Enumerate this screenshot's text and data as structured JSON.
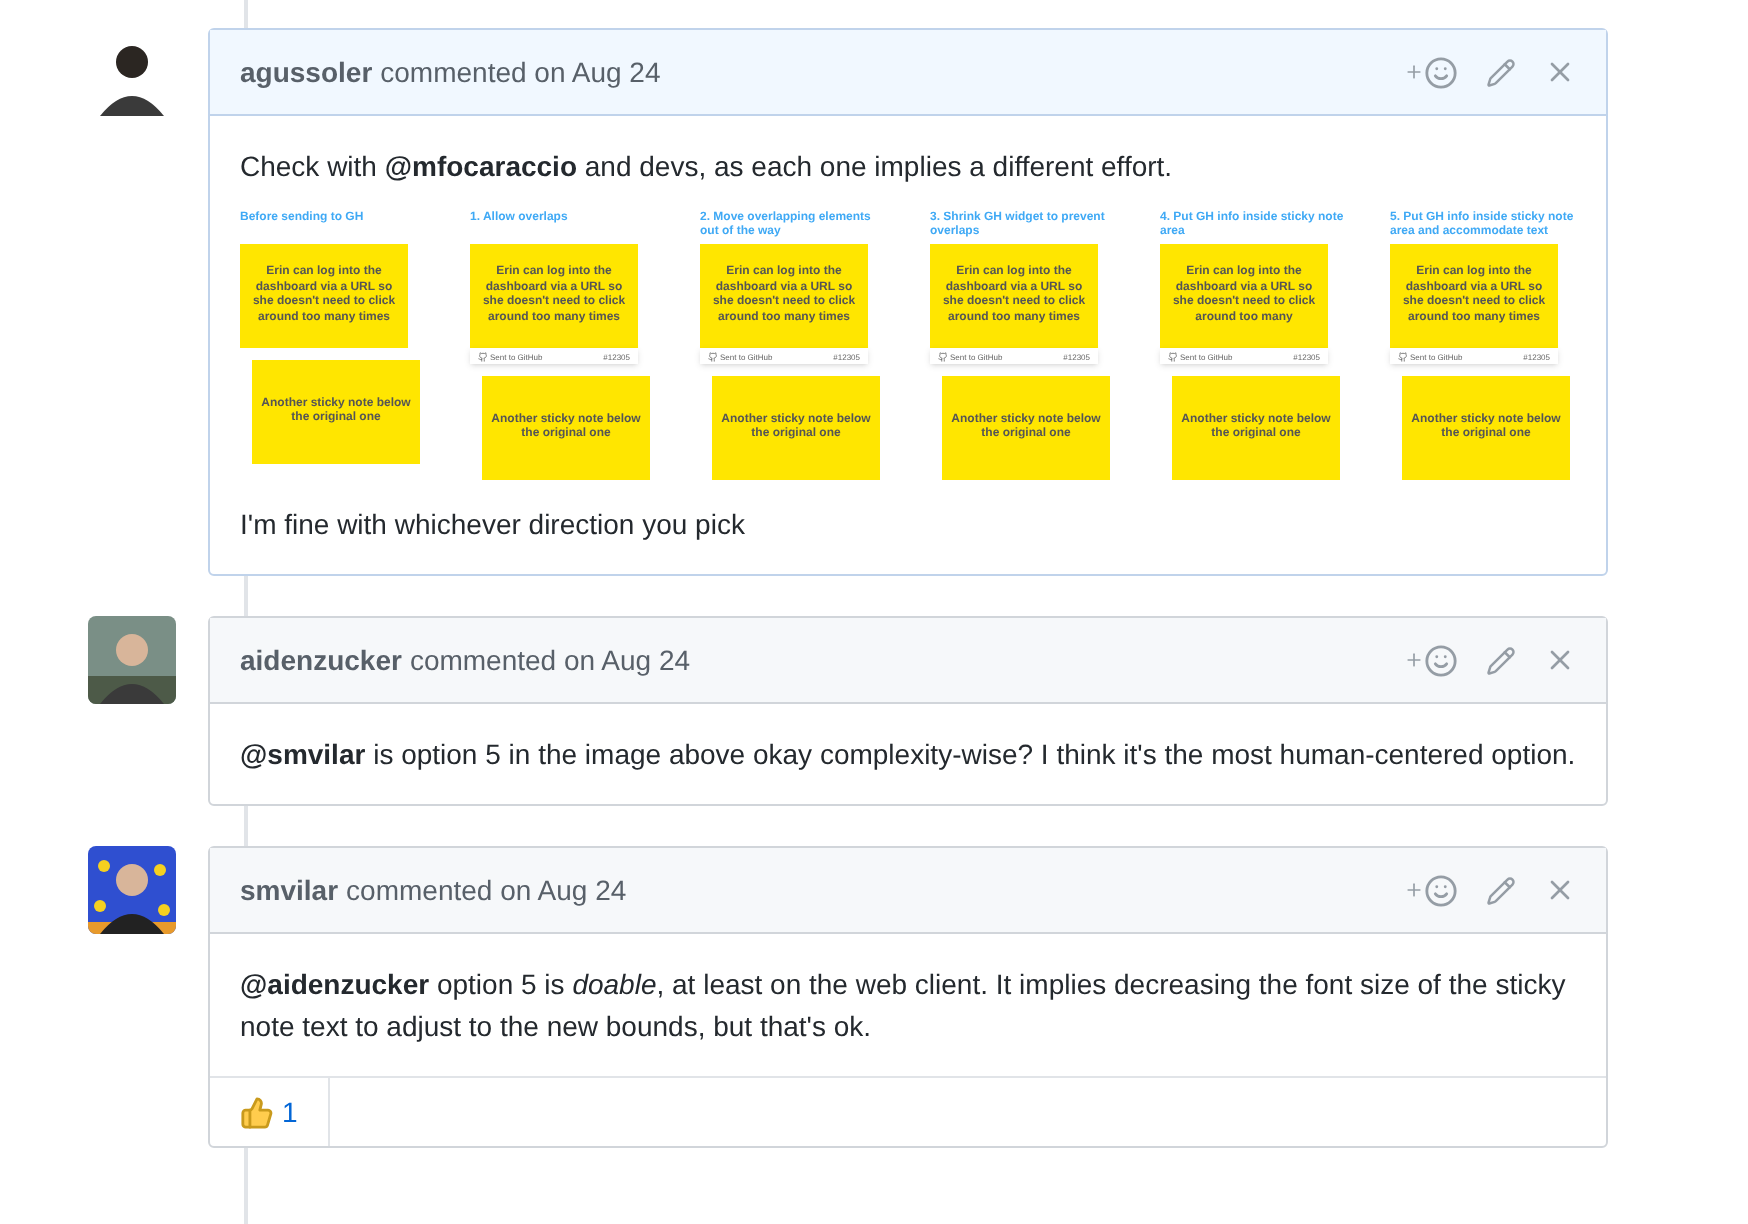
{
  "comments": [
    {
      "author": "agussoler",
      "action": "commented on Aug 24",
      "highlighted": true,
      "avatar": {
        "kind": "plain"
      },
      "body": [
        {
          "kind": "text",
          "text": "Check with **@mfocaraccio** and devs, as each one implies a different effort."
        },
        {
          "kind": "mockups",
          "columns": [
            {
              "title": "Before sending to GH",
              "note": "Erin can log into the dashboard via a URL so she doesn't need to click around too many times",
              "second_note": "Another sticky note below the original one"
            },
            {
              "title": "1. Allow overlaps",
              "note": "Erin can log into the dashboard via a URL so she doesn't need to click around too many times",
              "github_bar": {
                "label": "Sent to GitHub",
                "number": "#12305"
              },
              "second_note": "Another sticky note below the original one"
            },
            {
              "title": "2. Move overlapping elements out of the way",
              "note": "Erin can log into the dashboard via a URL so she doesn't need to click around too many times",
              "github_bar": {
                "label": "Sent to GitHub",
                "number": "#12305"
              },
              "second_note": "Another sticky note below the original one"
            },
            {
              "title": "3. Shrink GH widget to prevent overlaps",
              "note": "Erin can log into the dashboard via a URL so she doesn't need to click around too many times",
              "github_bar": {
                "label": "Sent to GitHub",
                "number": "#12305"
              },
              "second_note": "Another sticky note below the original one"
            },
            {
              "title": "4. Put GH info inside sticky note area",
              "note": "Erin can log into the dashboard via a URL so she doesn't need to click around too many",
              "github_bar": {
                "label": "Sent to GitHub",
                "number": "#12305"
              },
              "second_note": "Another sticky note below the original one"
            },
            {
              "title": "5. Put GH info inside sticky note area and accommodate text",
              "note": "Erin can log into the dashboard via a URL so she doesn't need to click around too many times",
              "github_bar": {
                "label": "Sent to GitHub",
                "number": "#12305"
              },
              "second_note": "Another sticky note below the original one"
            }
          ]
        },
        {
          "kind": "text",
          "text": "I'm fine with whichever direction you pick"
        }
      ]
    },
    {
      "author": "aidenzucker",
      "action": "commented on Aug 24",
      "highlighted": false,
      "avatar": {
        "kind": "outdoor"
      },
      "body": [
        {
          "kind": "text",
          "text": "**@smvilar** is option 5 in the image above okay complexity-wise? I think it's the most human-centered option."
        }
      ]
    },
    {
      "author": "smvilar",
      "action": "commented on Aug 24",
      "highlighted": false,
      "avatar": {
        "kind": "stars"
      },
      "body": [
        {
          "kind": "text",
          "text": "**@aidenzucker** option 5 is *doable*, at least on the web client. It implies decreasing the font size of the sticky note text to adjust to the new bounds, but that's ok."
        }
      ],
      "reactions": [
        {
          "count": "1"
        }
      ]
    }
  ]
}
